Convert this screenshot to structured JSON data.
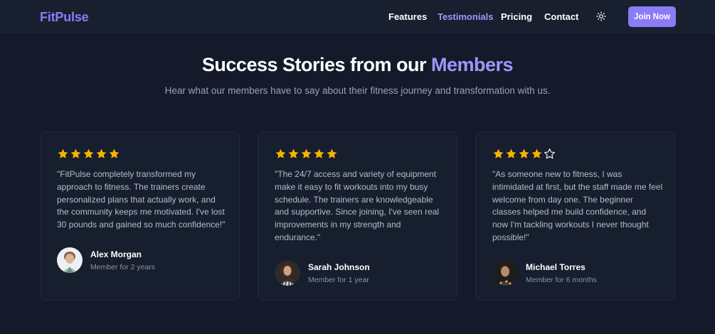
{
  "nav": {
    "logo": "FitPulse",
    "links": [
      "Features",
      "Testimonials",
      "Pricing",
      "Contact"
    ],
    "active_link": "Testimonials",
    "theme_icon": "sun-icon",
    "join_label": "Join Now"
  },
  "hero": {
    "title_main": "Success Stories from our ",
    "title_accent": "Members",
    "subtitle": "Hear what our members have to say about their fitness journey and transformation with us."
  },
  "testimonials": [
    {
      "rating": 5,
      "quote": "\"FitPulse completely transformed my approach to fitness. The trainers create personalized plans that actually work, and the community keeps me motivated. I've lost 30 pounds and gained so much confidence!\"",
      "name": "Alex Morgan",
      "tenure": "Member for 2 years"
    },
    {
      "rating": 5,
      "quote": "\"The 24/7 access and variety of equipment make it easy to fit workouts into my busy schedule. The trainers are knowledgeable and supportive. Since joining, I've seen real improvements in my strength and endurance.\"",
      "name": "Sarah Johnson",
      "tenure": "Member for 1 year"
    },
    {
      "rating": 4,
      "quote": "\"As someone new to fitness, I was intimidated at first, but the staff made me feel welcome from day one. The beginner classes helped me build confidence, and now I'm tackling workouts I never thought possible!\"",
      "name": "Michael Torres",
      "tenure": "Member for 6 months"
    }
  ],
  "colors": {
    "accent": "#8b7cf6",
    "star": "#f5b301",
    "background": "#141a2a"
  }
}
